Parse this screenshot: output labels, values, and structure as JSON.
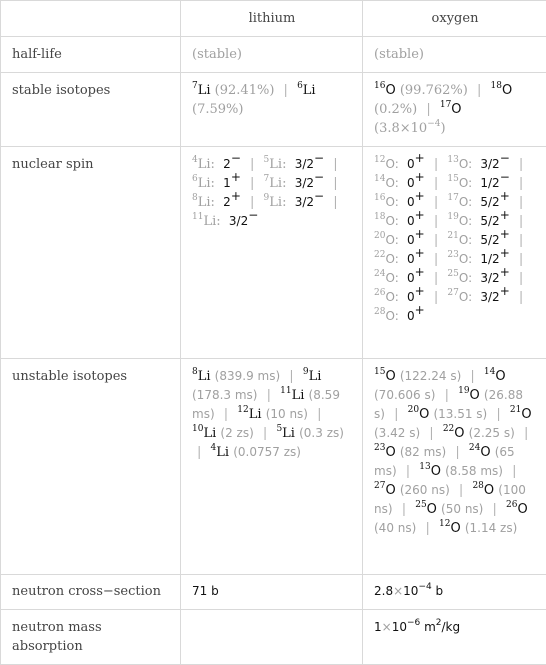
{
  "header": {
    "corner": "",
    "col1": "lithium",
    "col2": "oxygen"
  },
  "rows": {
    "half_life": {
      "label": "half-life",
      "lithium": "(stable)",
      "oxygen": "(stable)"
    },
    "stable_isotopes": {
      "label": "stable isotopes",
      "lithium": [
        {
          "mass": "7",
          "symbol": "Li",
          "value": "(92.41%)"
        },
        {
          "mass": "6",
          "symbol": "Li",
          "value": "(7.59%)"
        }
      ],
      "oxygen": [
        {
          "mass": "16",
          "symbol": "O",
          "value": "(99.762%)"
        },
        {
          "mass": "18",
          "symbol": "O",
          "value": "(0.2%)"
        },
        {
          "mass": "17",
          "symbol": "O",
          "value": "(3.8×10",
          "exp": "−4",
          "tail": ")"
        }
      ]
    },
    "nuclear_spin": {
      "label": "nuclear spin",
      "lithium": [
        {
          "mass": "4",
          "symbol": "Li",
          "spin": "2",
          "parity": "−"
        },
        {
          "mass": "5",
          "symbol": "Li",
          "spin": "3/2",
          "parity": "−"
        },
        {
          "mass": "6",
          "symbol": "Li",
          "spin": "1",
          "parity": "+"
        },
        {
          "mass": "7",
          "symbol": "Li",
          "spin": "3/2",
          "parity": "−"
        },
        {
          "mass": "8",
          "symbol": "Li",
          "spin": "2",
          "parity": "+"
        },
        {
          "mass": "9",
          "symbol": "Li",
          "spin": "3/2",
          "parity": "−"
        },
        {
          "mass": "11",
          "symbol": "Li",
          "spin": "3/2",
          "parity": "−"
        }
      ],
      "oxygen": [
        {
          "mass": "12",
          "symbol": "O",
          "spin": "0",
          "parity": "+"
        },
        {
          "mass": "13",
          "symbol": "O",
          "spin": "3/2",
          "parity": "−"
        },
        {
          "mass": "14",
          "symbol": "O",
          "spin": "0",
          "parity": "+"
        },
        {
          "mass": "15",
          "symbol": "O",
          "spin": "1/2",
          "parity": "−"
        },
        {
          "mass": "16",
          "symbol": "O",
          "spin": "0",
          "parity": "+"
        },
        {
          "mass": "17",
          "symbol": "O",
          "spin": "5/2",
          "parity": "+"
        },
        {
          "mass": "18",
          "symbol": "O",
          "spin": "0",
          "parity": "+"
        },
        {
          "mass": "19",
          "symbol": "O",
          "spin": "5/2",
          "parity": "+"
        },
        {
          "mass": "20",
          "symbol": "O",
          "spin": "0",
          "parity": "+"
        },
        {
          "mass": "21",
          "symbol": "O",
          "spin": "5/2",
          "parity": "+"
        },
        {
          "mass": "22",
          "symbol": "O",
          "spin": "0",
          "parity": "+"
        },
        {
          "mass": "23",
          "symbol": "O",
          "spin": "1/2",
          "parity": "+"
        },
        {
          "mass": "24",
          "symbol": "O",
          "spin": "0",
          "parity": "+"
        },
        {
          "mass": "25",
          "symbol": "O",
          "spin": "3/2",
          "parity": "+"
        },
        {
          "mass": "26",
          "symbol": "O",
          "spin": "0",
          "parity": "+"
        },
        {
          "mass": "27",
          "symbol": "O",
          "spin": "3/2",
          "parity": "+"
        },
        {
          "mass": "28",
          "symbol": "O",
          "spin": "0",
          "parity": "+"
        }
      ]
    },
    "unstable_isotopes": {
      "label": "unstable isotopes",
      "lithium": [
        {
          "mass": "8",
          "symbol": "Li",
          "value": "(839.9 ms)"
        },
        {
          "mass": "9",
          "symbol": "Li",
          "value": "(178.3 ms)"
        },
        {
          "mass": "11",
          "symbol": "Li",
          "value": "(8.59 ms)"
        },
        {
          "mass": "12",
          "symbol": "Li",
          "value": "(10 ns)"
        },
        {
          "mass": "10",
          "symbol": "Li",
          "value": "(2 zs)"
        },
        {
          "mass": "5",
          "symbol": "Li",
          "value": "(0.3 zs)"
        },
        {
          "mass": "4",
          "symbol": "Li",
          "value": "(0.0757 zs)"
        }
      ],
      "oxygen": [
        {
          "mass": "15",
          "symbol": "O",
          "value": "(122.24 s)"
        },
        {
          "mass": "14",
          "symbol": "O",
          "value": "(70.606 s)"
        },
        {
          "mass": "19",
          "symbol": "O",
          "value": "(26.88 s)"
        },
        {
          "mass": "20",
          "symbol": "O",
          "value": "(13.51 s)"
        },
        {
          "mass": "21",
          "symbol": "O",
          "value": "(3.42 s)"
        },
        {
          "mass": "22",
          "symbol": "O",
          "value": "(2.25 s)"
        },
        {
          "mass": "23",
          "symbol": "O",
          "value": "(82 ms)"
        },
        {
          "mass": "24",
          "symbol": "O",
          "value": "(65 ms)"
        },
        {
          "mass": "13",
          "symbol": "O",
          "value": "(8.58 ms)"
        },
        {
          "mass": "27",
          "symbol": "O",
          "value": "(260 ns)"
        },
        {
          "mass": "28",
          "symbol": "O",
          "value": "(100 ns)"
        },
        {
          "mass": "25",
          "symbol": "O",
          "value": "(50 ns)"
        },
        {
          "mass": "26",
          "symbol": "O",
          "value": "(40 ns)"
        },
        {
          "mass": "12",
          "symbol": "O",
          "value": "(1.14 zs)"
        }
      ]
    },
    "neutron_cross_section": {
      "label": "neutron cross−section",
      "lithium": "71 b",
      "oxygen": {
        "mantissa": "2.8",
        "times": "×",
        "base": "10",
        "exp": "−4",
        "unit": " b"
      }
    },
    "neutron_mass_absorption": {
      "label": "neutron mass absorption",
      "lithium": "",
      "oxygen": {
        "mantissa": "1",
        "times": "×",
        "base": "10",
        "exp": "−6",
        "unit": " m",
        "unit_exp": "2",
        "unit_tail": "/kg"
      }
    }
  },
  "separator": "|"
}
